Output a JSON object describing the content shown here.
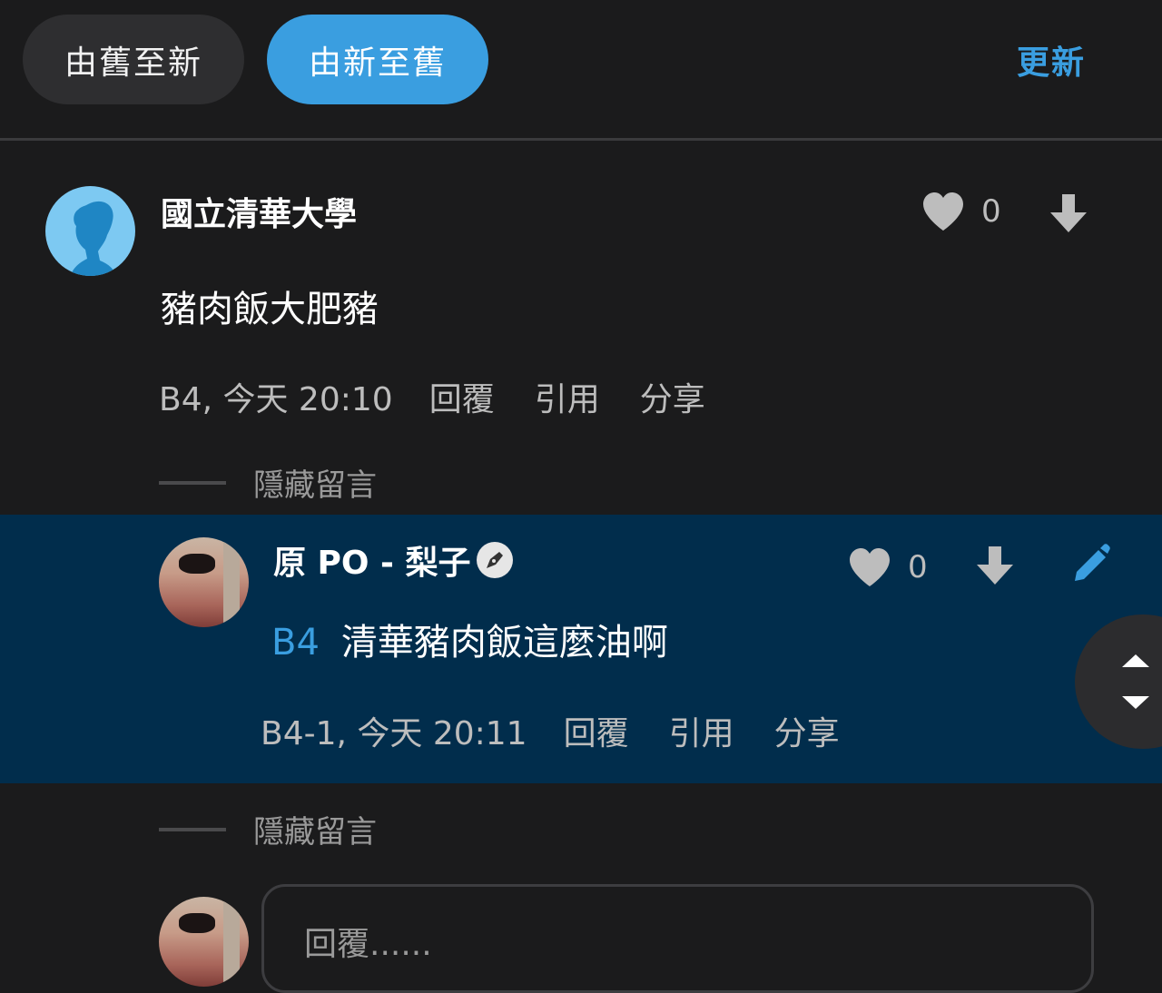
{
  "sort_bar": {
    "oldest_first_label": "由舊至新",
    "newest_first_label": "由新至舊",
    "refresh_label": "更新"
  },
  "comment": {
    "author": "國立清華大學",
    "text": "豬肉飯大肥豬",
    "floor": "B4, 今天 20:10",
    "likes": "0",
    "actions": {
      "reply": "回覆",
      "quote": "引用",
      "share": "分享"
    },
    "hide_label": "隱藏留言"
  },
  "reply": {
    "author": "原 PO - 梨子",
    "tag": "B4",
    "text": "清華豬肉飯這麼油啊",
    "floor": "B4-1, 今天 20:11",
    "likes": "0",
    "actions": {
      "reply": "回覆",
      "quote": "引用",
      "share": "分享"
    },
    "hide_label": "隱藏留言"
  },
  "reply_box": {
    "placeholder": "回覆......"
  },
  "colors": {
    "accent": "#3a9ee0",
    "background": "#1b1b1c",
    "highlight": "#012d4c",
    "icon_gray": "#bdbdbd"
  },
  "icons": [
    "heart-icon",
    "downvote-icon",
    "edit-icon",
    "author-badge-icon",
    "scroll-updown-icon"
  ]
}
